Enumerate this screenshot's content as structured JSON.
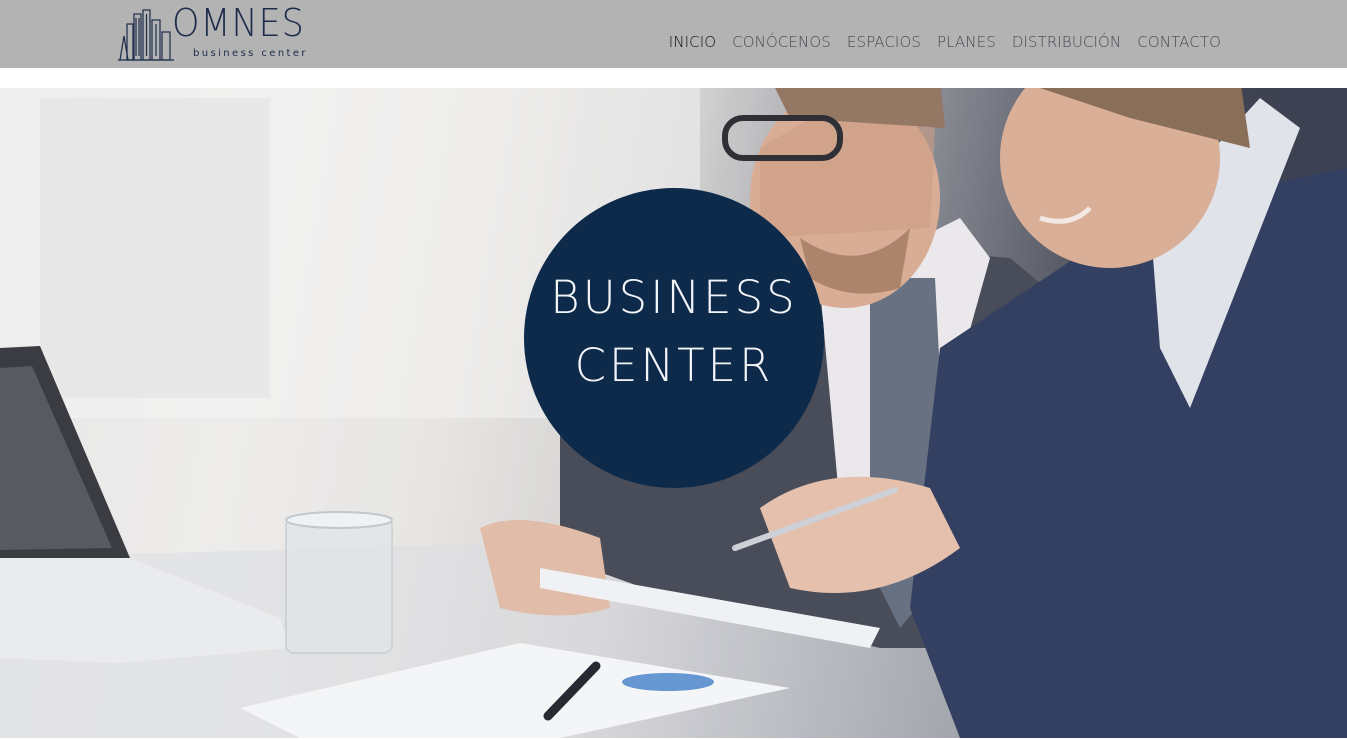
{
  "header": {
    "logo": {
      "wordmark": "OMNES",
      "tagline": "business center",
      "icon": "city-buildings-icon"
    },
    "nav": [
      {
        "label": "INICIO",
        "active": true
      },
      {
        "label": "CONÓCENOS",
        "active": false
      },
      {
        "label": "ESPACIOS",
        "active": false
      },
      {
        "label": "PLANES",
        "active": false
      },
      {
        "label": "DISTRIBUCIÓN",
        "active": false
      },
      {
        "label": "CONTACTO",
        "active": false
      }
    ]
  },
  "hero": {
    "badge_line1": "BUSINESS",
    "badge_line2": "CENTER",
    "image": "business-meeting-photo"
  },
  "colors": {
    "header_bg": "#b3b3b3",
    "brand_navy": "#0d2a4b",
    "nav_text": "#454a52"
  }
}
